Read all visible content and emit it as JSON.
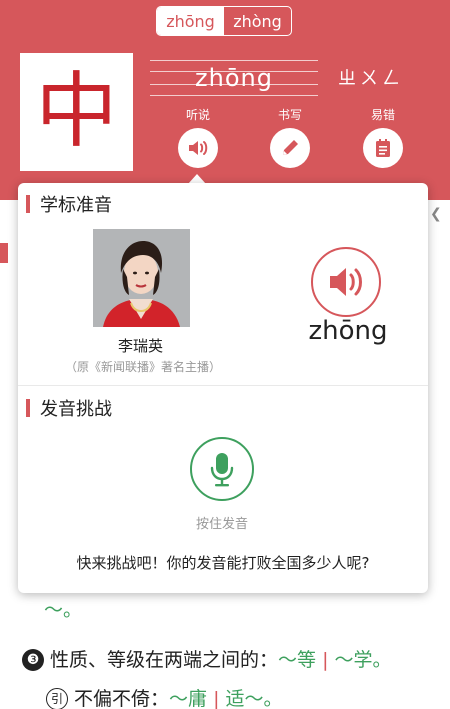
{
  "pronunciations": [
    {
      "label": "zhōng",
      "active": true
    },
    {
      "label": "zhòng",
      "active": false
    }
  ],
  "character": "中",
  "pinyin": "zhōng",
  "zhuyin": "ㄓㄨㄥ",
  "actions": [
    {
      "label": "听说",
      "icon": "speaker-icon"
    },
    {
      "label": "书写",
      "icon": "pencil-icon"
    },
    {
      "label": "易错",
      "icon": "notepad-icon"
    }
  ],
  "popup": {
    "standard": {
      "title": "学标准音",
      "name": "李瑞英",
      "desc": "（原《新闻联播》著名主播）",
      "pinyin": "zhōng"
    },
    "challenge": {
      "title": "发音挑战",
      "mic_label": "按住发音",
      "prompt": "快来挑战吧！你的发音能打败全国多少人呢?"
    }
  },
  "background": {
    "line_fragment": "～。",
    "def3": {
      "num": "❸",
      "text": "性质、等级在两端之间的：",
      "ex1": "～等",
      "sep": "|",
      "ex2": "～学。"
    },
    "yin": {
      "mark": "引",
      "text": "不偏不倚：",
      "ex1": "～庸",
      "sep": "|",
      "ex2": "适～。"
    }
  },
  "colors": {
    "header_red": "#d6575b",
    "char_red": "#c9252c",
    "mic_green": "#3ea05e"
  }
}
